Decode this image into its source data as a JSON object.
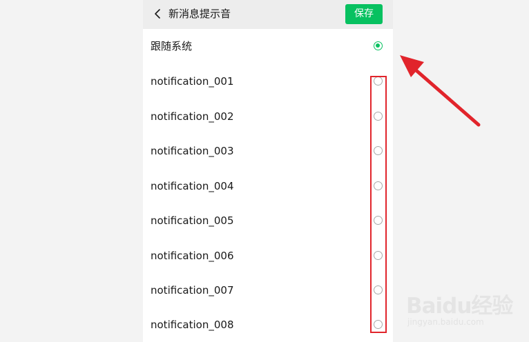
{
  "header": {
    "title": "新消息提示音",
    "save_label": "保存"
  },
  "options": [
    {
      "label": "跟随系统",
      "selected": true
    },
    {
      "label": "notification_001",
      "selected": false
    },
    {
      "label": "notification_002",
      "selected": false
    },
    {
      "label": "notification_003",
      "selected": false
    },
    {
      "label": "notification_004",
      "selected": false
    },
    {
      "label": "notification_005",
      "selected": false
    },
    {
      "label": "notification_006",
      "selected": false
    },
    {
      "label": "notification_007",
      "selected": false
    },
    {
      "label": "notification_008",
      "selected": false
    }
  ],
  "watermark": {
    "brand": "Baidu经验",
    "sub": "jingyan.baidu.com"
  },
  "colors": {
    "accent": "#07c160",
    "annotation": "#e1242b",
    "page_background": "#f3f3f3",
    "topbar_background": "#ededed"
  },
  "icons": {
    "back": "chevron-left-icon",
    "annotation_arrow": "arrow-icon"
  }
}
